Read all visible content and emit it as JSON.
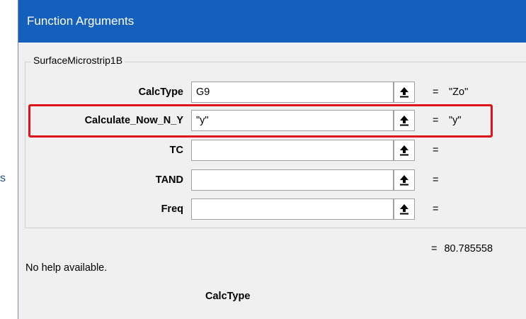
{
  "background_fragment": "s",
  "dialog": {
    "title": "Function Arguments",
    "function_name": "SurfaceMicrostrip1B",
    "title_color": "#1560bd",
    "highlight_color": "#e0121b"
  },
  "arguments": [
    {
      "label": "CalcType",
      "value": "G9",
      "equals": "=",
      "result": "\"Zo\""
    },
    {
      "label": "Calculate_Now_N_Y",
      "value": "\"y\"",
      "equals": "=",
      "result": "\"y\""
    },
    {
      "label": "TC",
      "value": "",
      "equals": "=",
      "result": ""
    },
    {
      "label": "TAND",
      "value": "",
      "equals": "=",
      "result": ""
    },
    {
      "label": "Freq",
      "value": "",
      "equals": "=",
      "result": ""
    }
  ],
  "collapse_icon": "arrow-up-collapse-icon",
  "formula_result": {
    "equals": "=",
    "value": "80.785558"
  },
  "help_text": "No help available.",
  "argument_description_name": "CalcType"
}
